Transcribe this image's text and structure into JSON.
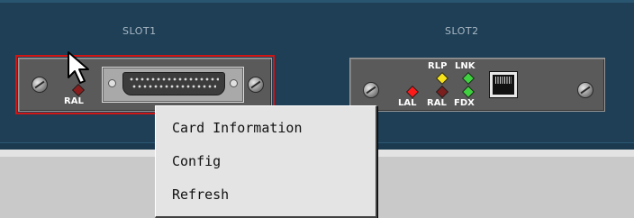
{
  "chassis": {
    "slots": [
      {
        "label": "SLOT1",
        "leds": [
          {
            "label": "RAL",
            "color": "#8a1e1e"
          }
        ]
      },
      {
        "label": "SLOT2",
        "leds": [
          {
            "label": "LAL",
            "color": "#ff1a1a"
          },
          {
            "label": "RAL",
            "color": "#7a1e1e"
          },
          {
            "label": "RLP",
            "color": "#f5e21a"
          },
          {
            "label": "LNK",
            "color": "#3fd13f"
          },
          {
            "label": "FDX",
            "color": "#3fd13f"
          }
        ]
      }
    ]
  },
  "context_menu": {
    "items": [
      "Card Information",
      "Config",
      "Refresh"
    ]
  },
  "colors": {
    "chassis_bg": "#1e3f56",
    "card_bg": "#5a5a5a",
    "selection_outline": "#d01515",
    "menu_bg": "#e4e4e4"
  }
}
